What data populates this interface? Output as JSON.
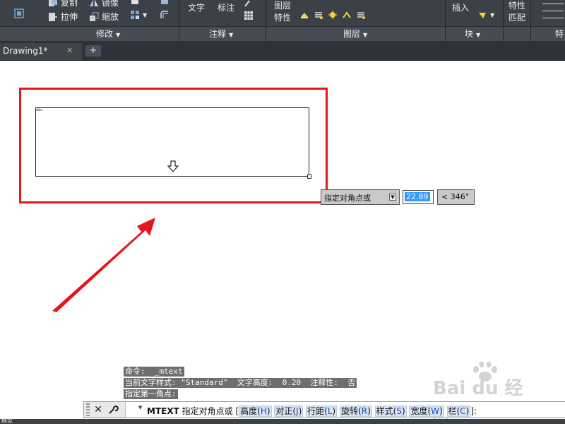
{
  "ribbon": {
    "buttons": {
      "copy": "复制",
      "mirror": "镜像",
      "stretch": "拉伸",
      "scale": "缩放",
      "text": "文字",
      "dimension": "标注",
      "layer_props_l1": "图层",
      "layer_props_l2": "特性",
      "insert": "插入",
      "props_l1": "特性",
      "match_l2": "匹配"
    },
    "panels": {
      "modify": "修改",
      "annotation": "注释",
      "layers": "图层",
      "block": "块",
      "properties": "特"
    }
  },
  "tabs": {
    "document": "Drawing1*",
    "close": "✕",
    "add": "+"
  },
  "drawing": {
    "small_mark": "abc",
    "prompt_label": "指定对角点或",
    "input_value": "22.89",
    "angle_value": "< 346°"
  },
  "command_history": [
    "命令:  _mtext",
    "当前文字样式: \"Standard\"  文字高度:  0.20  注释性:  否",
    "指定第一角点:"
  ],
  "command_line": {
    "command": "MTEXT",
    "prompt": "指定对角点或",
    "open_bracket": "[",
    "options": [
      {
        "label": "高度",
        "key": "H"
      },
      {
        "label": "对正",
        "key": "J"
      },
      {
        "label": "行距",
        "key": "L"
      },
      {
        "label": "旋转",
        "key": "R"
      },
      {
        "label": "样式",
        "key": "S"
      },
      {
        "label": "宽度",
        "key": "W"
      },
      {
        "label": "栏",
        "key": "C"
      }
    ],
    "close_bracket": "]:"
  },
  "status": {
    "left_label": "模型"
  },
  "watermark": {
    "text": "Bai du 经验"
  },
  "colors": {
    "ribbon_bg": "#3c4047",
    "highlight_red": "#e8141b",
    "selection_blue": "#3399ff"
  }
}
